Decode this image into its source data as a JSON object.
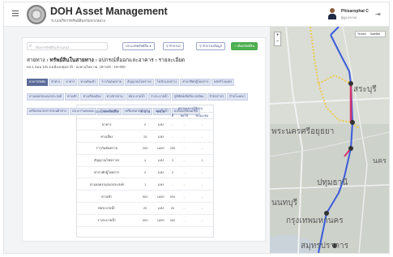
{
  "header": {
    "title": "DOH Asset Management",
    "subtitle": "ระบบบริหารทรัพย์สินกรมทางหลวง",
    "user_name": "Phisarophat C",
    "user_role": "ผู้ดูแลระบบ"
  },
  "toolbar": {
    "search_placeholder": "ค้นหาทรัพย์สิน/ตำแหน่ง...",
    "filter_category_label": "ประเภททรัพย์สิน ▾",
    "filter_label": "ตัวกรอง",
    "filter_data_label": "ตัวกรองข้อมูล",
    "add_button_label": "+ เพิ่มทรัพย์สิน"
  },
  "breadcrumb": [
    "สายทาง",
    "ทรัพย์สินในสายทาง",
    "อปกรณ์ที่ออกและอาคาร",
    "รายละเอียด"
  ],
  "asset_info": "ทล.1 ตอน 101 ดงเมืองปทุมธานี - สะพานใหม่ กม. 18+100 - 19+000",
  "chips": [
    "อาคารบังคับ",
    "ผิวทาง",
    "อาคาร",
    "ทางเดินเท้า",
    "ราวกันอันตราย",
    "สัญญาณไฟจราจร",
    "ไฟฟ้าแสงสว่าง",
    "ศาลาที่พักผู้โดยสาร",
    "หลักกิโลเมตร",
    "ลานจอดรถเอนกประสงค์",
    "ทางเท้า",
    "ทางเลี่ยงเมือง",
    "ทางจักรยาน",
    "ท่อระบายน้ำ",
    "รางระบายน้ำ",
    "ภูมิทัศน์เพื่อสิ่งแวดล้อม",
    "ป้ายจราจร",
    "ป้ายโฆษณา",
    "เครื่องหมายจราจรบนผิวทาง",
    "Glare Protection",
    "กำแพงกันเสียง",
    "เครื่องหมายนำทาง",
    "แผงกั้นน้ำ",
    "แบริเออร์คอนกรีต"
  ],
  "table": {
    "headers": {
      "type": "ประเภททรัพย์สิน",
      "qty": "จำนวน",
      "unit": "หน่วย",
      "status_group": "สถานะการใช้งาน",
      "good": "ดี",
      "fair": "พอใช้",
      "repair": "ซ่อมแซม"
    },
    "rows": [
      {
        "type": "อาคาร",
        "qty": "0",
        "unit": "แห่ง",
        "good": "-",
        "fair": "-",
        "repair": "-"
      },
      {
        "type": "ทางเลี่ยง",
        "qty": "15",
        "unit": "แห่ง",
        "good": "-",
        "fair": "-",
        "repair": "-"
      },
      {
        "type": "ราวกันอันตราย",
        "qty": "250",
        "unit": "เมตร",
        "good": "250",
        "fair": "-",
        "repair": "-"
      },
      {
        "type": "สัญญาณไฟจราจร",
        "qty": "4",
        "unit": "แห่ง",
        "good": "3",
        "fair": "-",
        "repair": "1"
      },
      {
        "type": "ศาลาพักผู้โดยสาร",
        "qty": "2",
        "unit": "แห่ง",
        "good": "2",
        "fair": "-",
        "repair": "-"
      },
      {
        "type": "ลานจอดรถเอนกประสงค์",
        "qty": "1",
        "unit": "แห่ง",
        "good": "-",
        "fair": "-",
        "repair": "-"
      },
      {
        "type": "ทางเท้า",
        "qty": "900",
        "unit": "เมตร",
        "good": "900",
        "fair": "-",
        "repair": "-"
      },
      {
        "type": "ท่อระบายน้ำ",
        "qty": "20",
        "unit": "แห่ง",
        "good": "20",
        "fair": "-",
        "repair": "-"
      },
      {
        "type": "รางระบายน้ำ",
        "qty": "900",
        "unit": "เมตร",
        "good": "900",
        "fair": "-",
        "repair": "-"
      }
    ]
  },
  "map": {
    "toggle": [
      "Terrain",
      "Satellite"
    ],
    "zoom_in": "+",
    "zoom_out": "−",
    "labels": {
      "sarburi": "สระบุรี",
      "ayutthaya": "พระนครศรีอยุธยา",
      "pathumthani": "ปทุมธานี",
      "nonthaburi": "นนทบุรี",
      "bangkok": "กรุงเทพมหานคร",
      "samutprakan": "สมุทรปราการ",
      "nakhon": "นคร"
    },
    "colors": {
      "route_blue": "#3b5bdb",
      "route_magenta": "#d6336c",
      "route_yellow": "#f2c94c"
    }
  }
}
